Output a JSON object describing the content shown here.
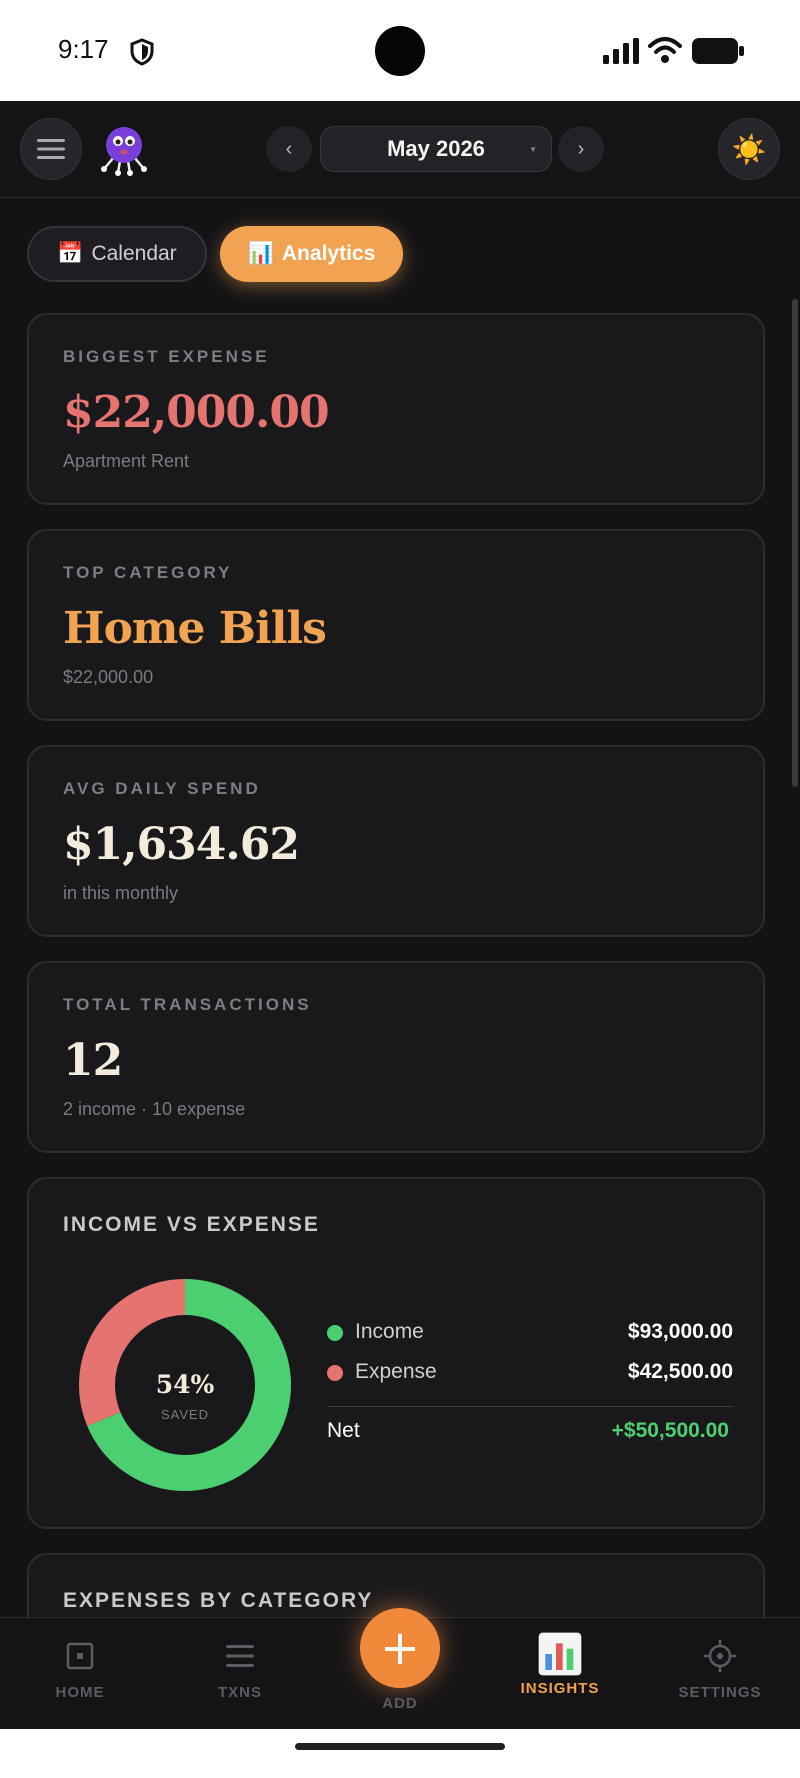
{
  "status_bar": {
    "time": "9:17"
  },
  "header": {
    "month": "May 2026"
  },
  "tabs": {
    "calendar_label": "Calendar",
    "analytics_label": "Analytics",
    "calendar_emoji": "📅",
    "analytics_emoji": "📊"
  },
  "stats": {
    "biggest_expense": {
      "label": "BIGGEST EXPENSE",
      "value": "$22,000.00",
      "sub": "Apartment Rent"
    },
    "top_category": {
      "label": "TOP CATEGORY",
      "value": "Home Bills",
      "sub": "$22,000.00"
    },
    "avg_daily": {
      "label": "AVG DAILY SPEND",
      "value": "$1,634.62",
      "sub": "in this monthly"
    },
    "total_tx": {
      "label": "TOTAL TRANSACTIONS",
      "value": "12",
      "sub": "2 income · 10 expense"
    }
  },
  "income_vs_expense": {
    "title": "INCOME VS EXPENSE",
    "center_value": "54%",
    "center_label": "SAVED",
    "income_label": "Income",
    "income_value": "$93,000.00",
    "expense_label": "Expense",
    "expense_value": "$42,500.00",
    "net_label": "Net",
    "net_value": "+$50,500.00",
    "income_amount": 93000,
    "expense_amount": 42500,
    "income_color": "#4ccf70",
    "expense_color": "#e5736f"
  },
  "expenses_by_category": {
    "title": "EXPENSES BY CATEGORY"
  },
  "bottom_nav": {
    "home": "HOME",
    "txns": "TXNS",
    "add": "ADD",
    "insights": "INSIGHTS",
    "settings": "SETTINGS"
  },
  "colors": {
    "accent": "#f1a351",
    "background": "#131316",
    "card": "#19191c",
    "positive": "#4ccf70",
    "negative": "#e5736f"
  }
}
